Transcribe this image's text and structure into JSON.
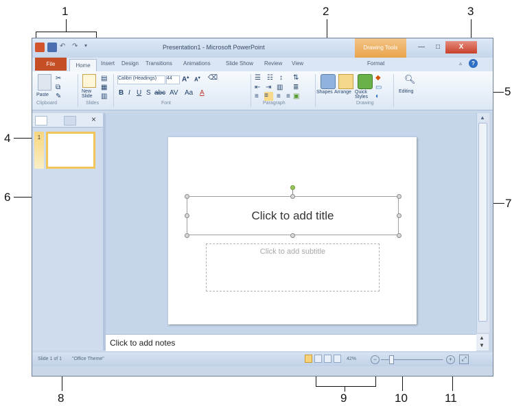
{
  "callouts": [
    "1",
    "2",
    "3",
    "4",
    "5",
    "6",
    "7",
    "8",
    "9",
    "10",
    "11"
  ],
  "window": {
    "title": "Presentation1 - Microsoft PowerPoint",
    "contextual_tab": "Drawing Tools",
    "close_label": "X"
  },
  "tabs": [
    "File",
    "Home",
    "Insert",
    "Design",
    "Transitions",
    "Animations",
    "Slide Show",
    "Review",
    "View",
    "Format"
  ],
  "ribbon": {
    "groups": [
      "Clipboard",
      "Slides",
      "Font",
      "Paragraph",
      "Drawing",
      "Editing"
    ],
    "paste_label": "Paste",
    "new_slide_label": "New Slide",
    "font_name": "Calibri (Headings)",
    "font_size": "44",
    "shapes_label": "Shapes",
    "arrange_label": "Arrange",
    "quick_styles_label": "Quick Styles",
    "editing_label": "Editing"
  },
  "slides_pane": {
    "thumbnail_number": "1"
  },
  "slide": {
    "title_placeholder": "Click to add title",
    "subtitle_placeholder": "Click to add subtitle"
  },
  "notes": {
    "placeholder": "Click to add notes"
  },
  "status": {
    "slide_count": "Slide 1 of 1",
    "theme": "\"Office Theme\"",
    "zoom": "42%"
  }
}
